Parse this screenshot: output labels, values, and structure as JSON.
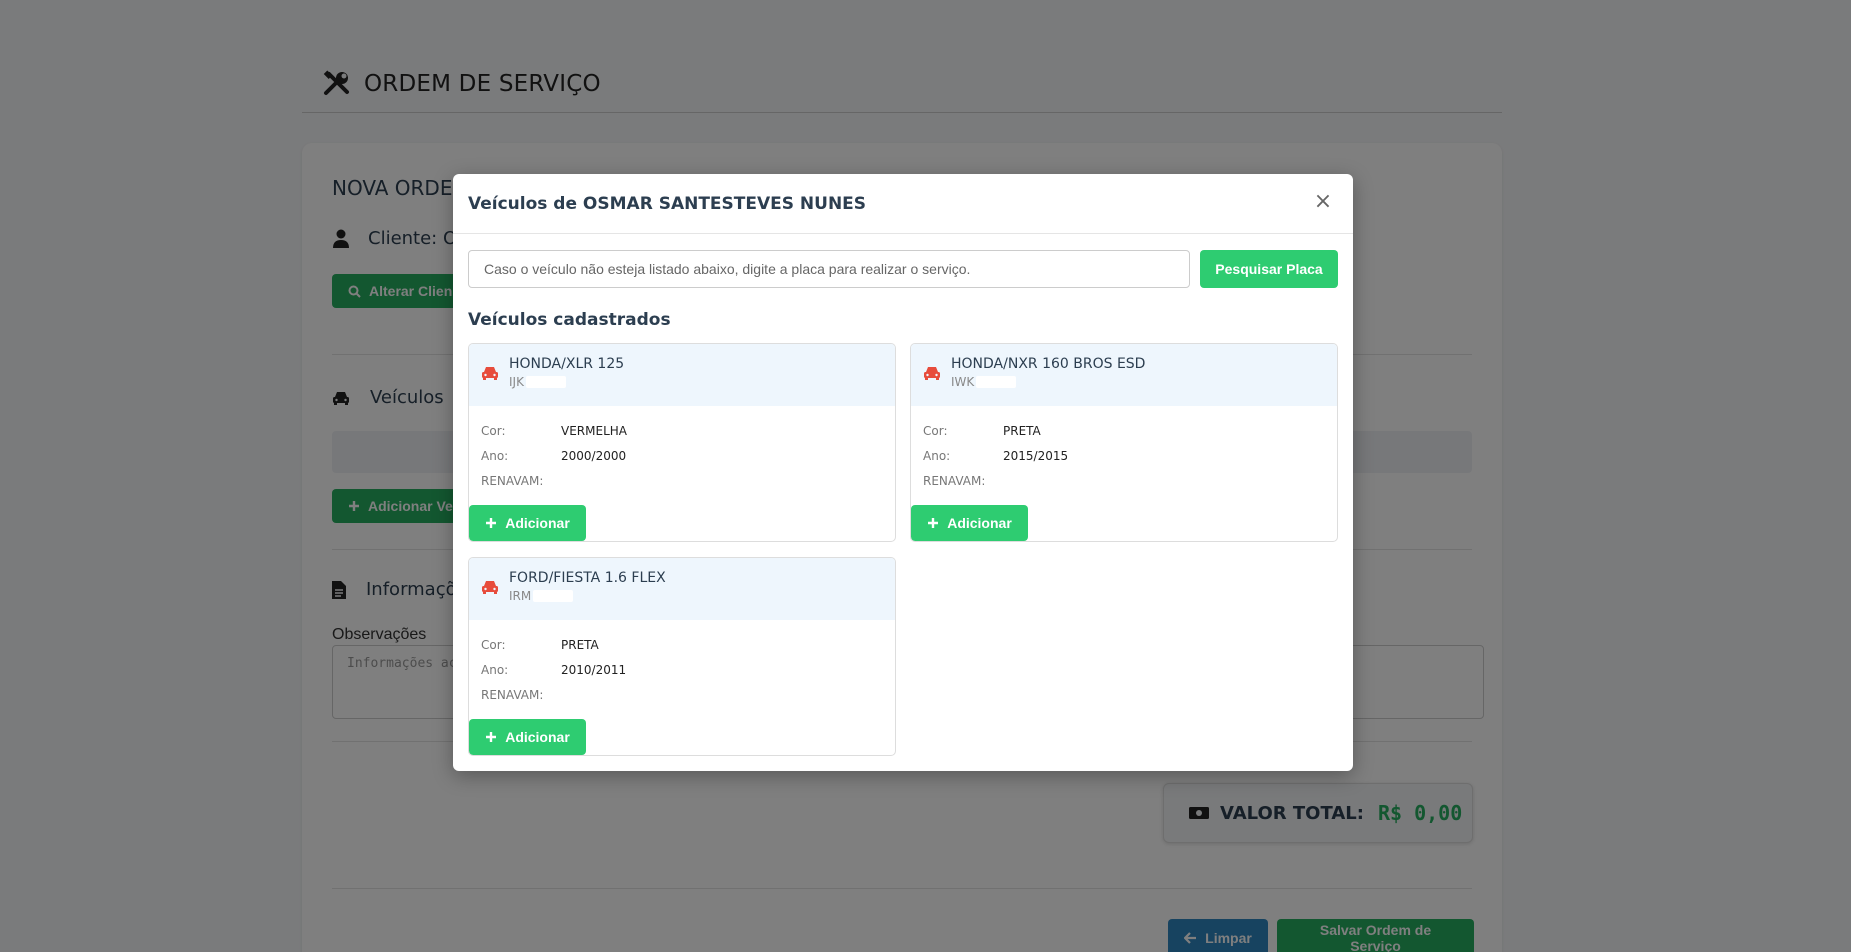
{
  "page": {
    "title": "ORDEM DE SERVIÇO",
    "card_title": "NOVA ORDE",
    "client_label": "Cliente: OS",
    "alter_client_label": "Alterar Clien",
    "vehicles_title": "Veículos",
    "add_vehicle_label": "Adicionar Ve",
    "info_title": "Informaçõ",
    "observations_label": "Observações",
    "observations_placeholder": "Informações ac",
    "total_label": "VALOR TOTAL:",
    "total_value": "R$ 0,00",
    "clear_label": "Limpar",
    "save_label": "Salvar Ordem de Serviço"
  },
  "modal": {
    "title": "Veículos de OSMAR SANTESTEVES NUNES",
    "close_glyph": "×",
    "search_placeholder": "Caso o veículo não esteja listado abaixo, digite a placa para realizar o serviço.",
    "search_button": "Pesquisar Placa",
    "list_title": "Veículos cadastrados",
    "labels": {
      "color": "Cor:",
      "year": "Ano:",
      "renavam": "RENAVAM:"
    },
    "add_button": "Adicionar",
    "vehicles": [
      {
        "name": "HONDA/XLR 125",
        "plate_prefix": "IJK",
        "color": "VERMELHA",
        "year": "2000/2000",
        "renavam": ""
      },
      {
        "name": "HONDA/NXR 160 BROS ESD",
        "plate_prefix": "IWK",
        "color": "PRETA",
        "year": "2015/2015",
        "renavam": ""
      },
      {
        "name": "FORD/FIESTA 1.6 FLEX",
        "plate_prefix": "IRM",
        "color": "PRETA",
        "year": "2010/2011",
        "renavam": ""
      }
    ]
  },
  "colors": {
    "green_primary": "#2ecc71",
    "green_dark": "#27ae60",
    "blue": "#2e86c1",
    "car_icon": "#e74c3c",
    "title_text": "#2c3e50"
  },
  "icons": {
    "header": "tools-icon",
    "client": "user-icon",
    "search": "search-icon",
    "vehicles": "car-icon",
    "plus": "plus-icon",
    "info": "file-icon",
    "money": "money-icon",
    "arrow_left": "arrow-left-icon",
    "close": "close-icon"
  }
}
